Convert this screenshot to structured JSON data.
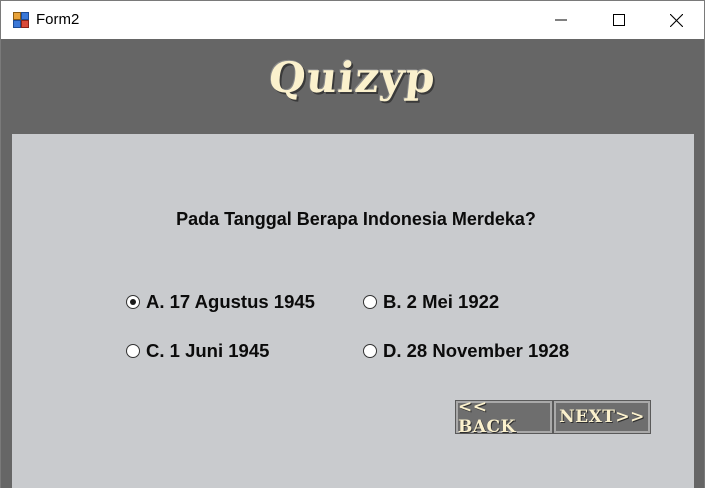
{
  "window": {
    "title": "Form2",
    "icons": {
      "app": "form-app-icon",
      "minimize": "minimize-icon",
      "maximize": "maximize-icon",
      "close": "close-icon"
    }
  },
  "header": {
    "logo_text": "Quizyp"
  },
  "quiz": {
    "question": "Pada Tanggal Berapa Indonesia Merdeka?",
    "options": [
      {
        "label": "A. 17 Agustus 1945",
        "selected": true
      },
      {
        "label": "B. 2 Mei 1922",
        "selected": false
      },
      {
        "label": "C. 1 Juni 1945",
        "selected": false
      },
      {
        "label": "D. 28 November 1928",
        "selected": false
      }
    ]
  },
  "buttons": {
    "back": "<< BACK",
    "next": "NEXT>>"
  },
  "colors": {
    "background": "#666666",
    "panel": "#c9cbce",
    "logo_text": "#fbf1cd",
    "button_face": "#6e6e6e"
  }
}
